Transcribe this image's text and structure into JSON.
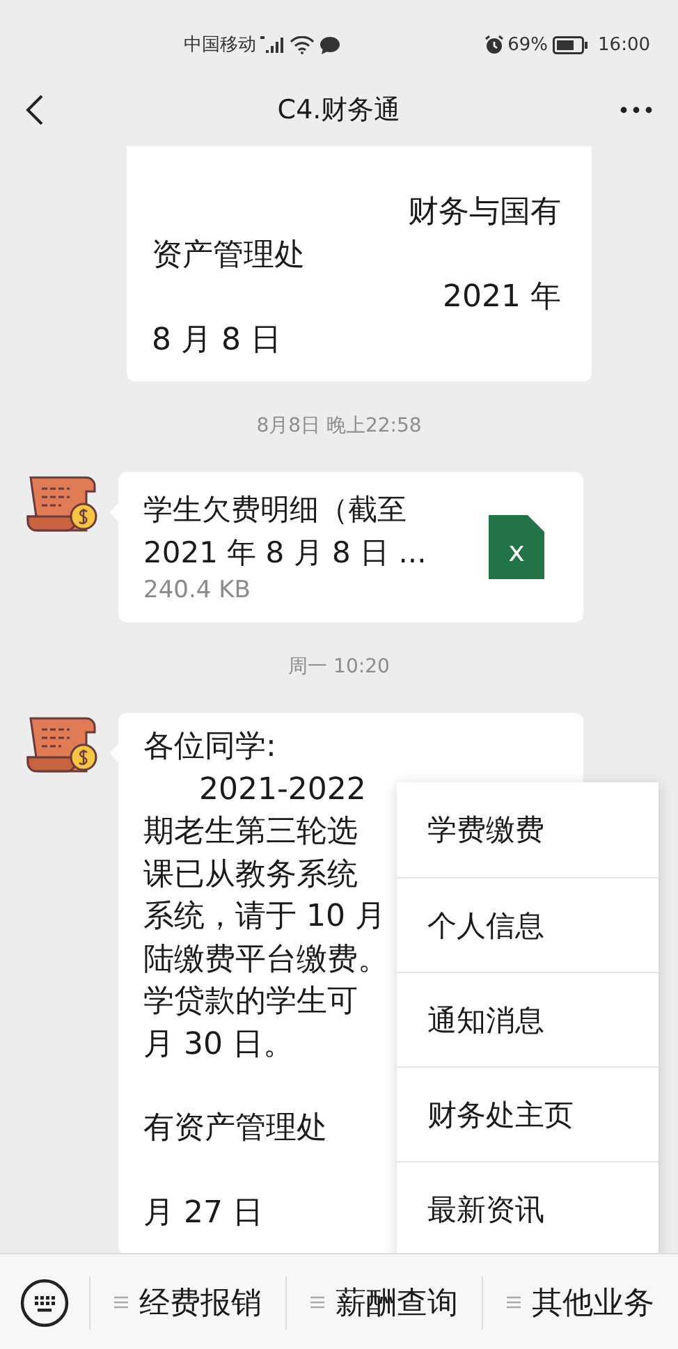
{
  "status_bar": {
    "carrier": "中国移动",
    "battery": "69%",
    "time": "16:00"
  },
  "header": {
    "title": "C4.财务通"
  },
  "messages": [
    {
      "kind": "text",
      "cut_top": true,
      "lines": [
        {
          "text": "财务与国有",
          "kind": "right"
        },
        {
          "text": "资产管理处",
          "kind": "left"
        },
        {
          "text": "2021 年",
          "kind": "right"
        },
        {
          "text": "8 月 8 日",
          "kind": "left"
        }
      ]
    },
    {
      "kind": "timestamp",
      "text": "8月8日 晚上22:58"
    },
    {
      "kind": "file",
      "name_lines": [
        "学生欠费明细（截至",
        "2021 年 8 月 8 日 ..."
      ],
      "size": "240.4 KB",
      "icon_label": "x"
    },
    {
      "kind": "timestamp",
      "text": "周一 10:20"
    },
    {
      "kind": "text",
      "cut_top": false,
      "lines": [
        {
          "text": "各位同学:",
          "kind": "left"
        },
        {
          "text": "2021-2022",
          "kind": "indent"
        },
        {
          "text": "期老生第三轮选",
          "kind": "left"
        },
        {
          "text": "课已从教务系统",
          "kind": "left"
        },
        {
          "text": "系统，请于 10 月",
          "kind": "left"
        },
        {
          "text": "陆缴费平台缴费。",
          "kind": "left"
        },
        {
          "text": "学贷款的学生可",
          "kind": "left"
        },
        {
          "text": "月 30 日。",
          "kind": "left"
        },
        {
          "kind": "blank"
        },
        {
          "text": "有资产管理处",
          "kind": "left"
        },
        {
          "kind": "blank"
        },
        {
          "text": "月 27 日",
          "kind": "left"
        }
      ]
    }
  ],
  "popup_menu": {
    "items": [
      "学费缴费",
      "个人信息",
      "通知消息",
      "财务处主页",
      "最新资讯"
    ]
  },
  "bottom_menu": {
    "items": [
      "经费报销",
      "薪酬查询",
      "其他业务"
    ]
  }
}
